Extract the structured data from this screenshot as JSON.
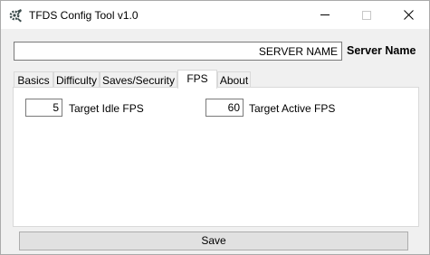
{
  "window": {
    "title": "TFDS Config Tool v1.0",
    "icon": "gear-wrench-icon"
  },
  "server": {
    "value": "SERVER NAME",
    "label": "Server Name"
  },
  "tabs": [
    {
      "label": "Basics",
      "active": false
    },
    {
      "label": "Difficulty",
      "active": false
    },
    {
      "label": "Saves/Security",
      "active": false
    },
    {
      "label": "FPS",
      "active": true
    },
    {
      "label": "About",
      "active": false
    }
  ],
  "fps": {
    "idle_value": "5",
    "idle_label": "Target Idle FPS",
    "active_value": "60",
    "active_label": "Target Active FPS"
  },
  "footer": {
    "save_label": "Save"
  }
}
